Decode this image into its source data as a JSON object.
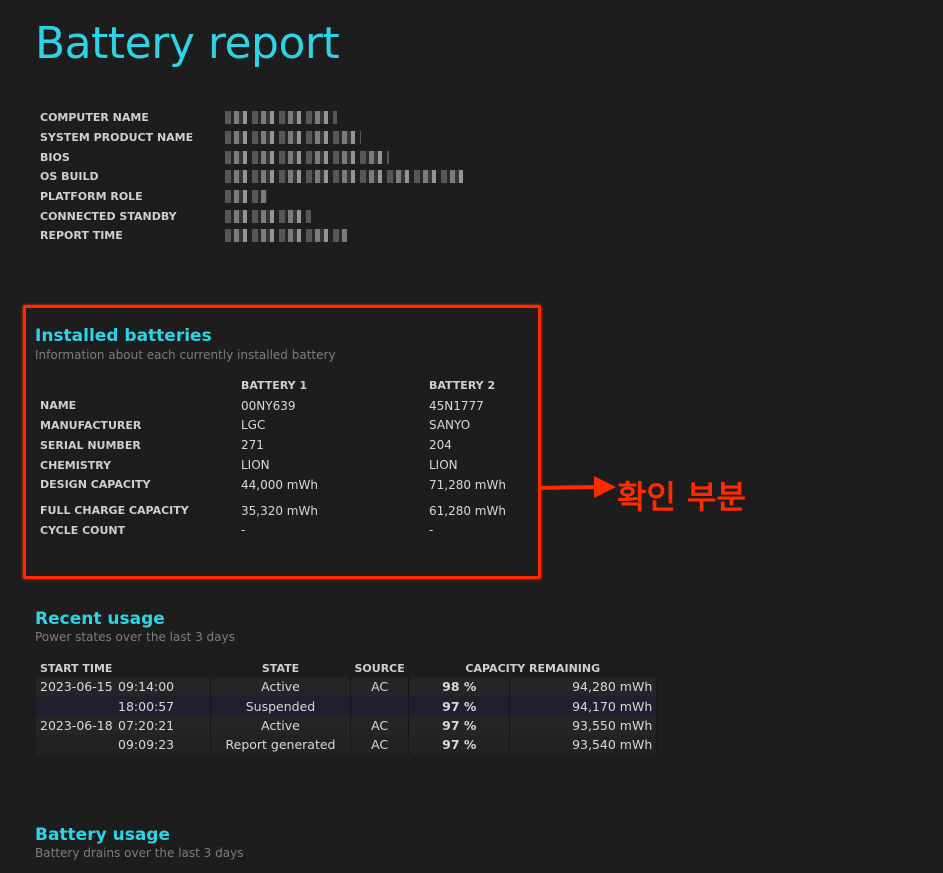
{
  "report_title": "Battery report",
  "system_info": {
    "labels": [
      "COMPUTER NAME",
      "SYSTEM PRODUCT NAME",
      "BIOS",
      "OS BUILD",
      "PLATFORM ROLE",
      "CONNECTED STANDBY",
      "REPORT TIME"
    ]
  },
  "installed_batteries": {
    "title": "Installed batteries",
    "subtitle": "Information about each currently installed battery",
    "headers": [
      "BATTERY 1",
      "BATTERY 2"
    ],
    "rows": [
      {
        "label": "NAME",
        "b1": "00NY639",
        "b2": "45N1777"
      },
      {
        "label": "MANUFACTURER",
        "b1": "LGC",
        "b2": "SANYO"
      },
      {
        "label": "SERIAL NUMBER",
        "b1": "271",
        "b2": "204"
      },
      {
        "label": "CHEMISTRY",
        "b1": "LION",
        "b2": "LION"
      },
      {
        "label": "DESIGN CAPACITY",
        "b1": "44,000 mWh",
        "b2": "71,280 mWh"
      },
      {
        "label": "FULL CHARGE CAPACITY",
        "b1": "35,320 mWh",
        "b2": "61,280 mWh"
      },
      {
        "label": "CYCLE COUNT",
        "b1": "-",
        "b2": "-"
      }
    ]
  },
  "annotation": {
    "text": "확인 부분",
    "color": "#ff2a00"
  },
  "recent_usage": {
    "title": "Recent usage",
    "subtitle": "Power states over the last 3 days",
    "headers": [
      "START TIME",
      "STATE",
      "SOURCE",
      "CAPACITY REMAINING"
    ],
    "rows": [
      {
        "date": "2023-06-15",
        "time": "09:14:00",
        "state": "Active",
        "source": "AC",
        "pct": "98 %",
        "cap": "94,280 mWh"
      },
      {
        "date": "",
        "time": "18:00:57",
        "state": "Suspended",
        "source": "",
        "pct": "97 %",
        "cap": "94,170 mWh"
      },
      {
        "date": "2023-06-18",
        "time": "07:20:21",
        "state": "Active",
        "source": "AC",
        "pct": "97 %",
        "cap": "93,550 mWh"
      },
      {
        "date": "",
        "time": "09:09:23",
        "state": "Report generated",
        "source": "AC",
        "pct": "97 %",
        "cap": "93,540 mWh"
      }
    ]
  },
  "battery_usage": {
    "title": "Battery usage",
    "subtitle": "Battery drains over the last 3 days"
  },
  "colors": {
    "accent": "#2fd3e6",
    "background": "#1d1d1d"
  }
}
